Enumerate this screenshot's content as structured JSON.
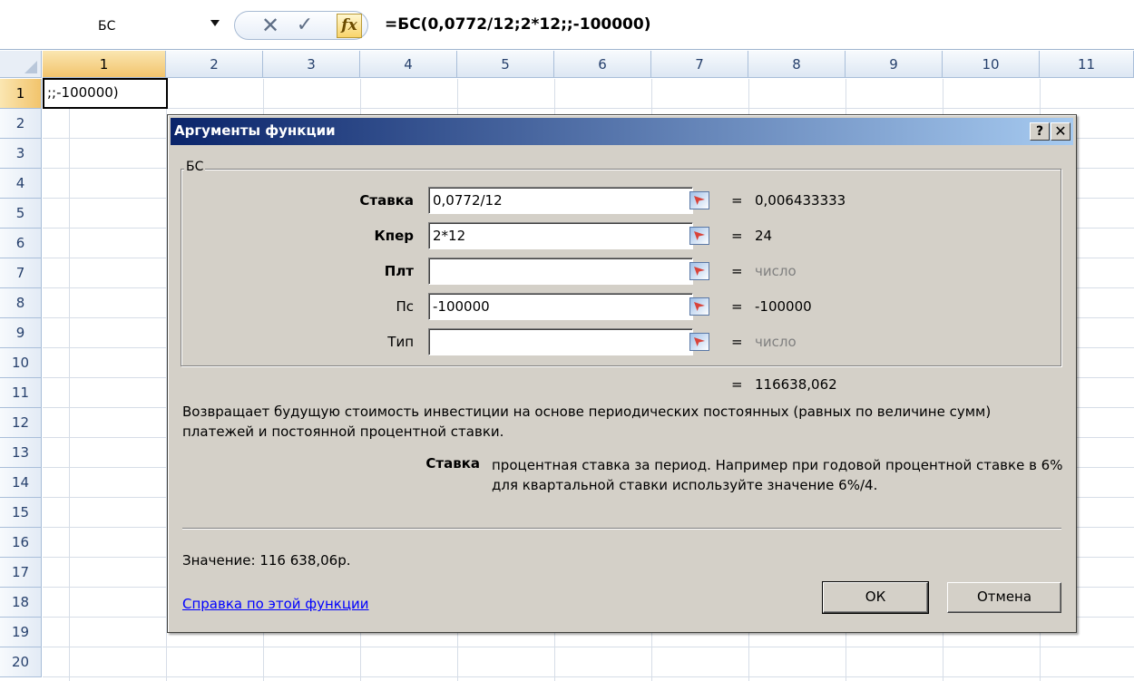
{
  "formula_bar": {
    "name_box": "БС",
    "cancel_glyph": "✕",
    "enter_glyph": "✓",
    "insert_function_label": "fx",
    "formula": "=БС(0,0772/12;2*12;;-100000)"
  },
  "sheet": {
    "columns": [
      "1",
      "2",
      "3",
      "4",
      "5",
      "6",
      "7",
      "8",
      "9",
      "10",
      "11"
    ],
    "rows": [
      "1",
      "2",
      "3",
      "4",
      "5",
      "6",
      "7",
      "8",
      "9",
      "10",
      "11",
      "12",
      "13",
      "14",
      "15",
      "16",
      "17",
      "18",
      "19",
      "20"
    ],
    "active_column": "1",
    "active_row": "1",
    "cell_a1_text": ";;-100000)"
  },
  "dialog": {
    "title": "Аргументы функции",
    "help_button": "?",
    "close_button": "✕",
    "function_name": "БС",
    "arguments": [
      {
        "label": "Ставка",
        "bold": true,
        "value": "0,0772/12",
        "result": "0,006433333",
        "result_placeholder": false
      },
      {
        "label": "Кпер",
        "bold": true,
        "value": "2*12",
        "result": "24",
        "result_placeholder": false
      },
      {
        "label": "Плт",
        "bold": true,
        "value": "",
        "result": "число",
        "result_placeholder": true
      },
      {
        "label": "Пс",
        "bold": false,
        "value": "-100000",
        "result": "-100000",
        "result_placeholder": false
      },
      {
        "label": "Тип",
        "bold": false,
        "value": "",
        "result": "число",
        "result_placeholder": true
      }
    ],
    "equals": "=",
    "formula_result": "116638,062",
    "description": "Возвращает будущую стоимость инвестиции на основе периодических постоянных (равных по величине сумм) платежей и постоянной процентной ставки.",
    "argument_help_name": "Ставка",
    "argument_help_text": "процентная ставка за период. Например при годовой процентной ставке в 6% для квартальной ставки используйте значение 6%/4.",
    "value_label": "Значение:",
    "value": "116 638,06р.",
    "help_link": "Справка по этой функции",
    "ok_button": "ОК",
    "cancel_button": "Отмена"
  },
  "colors": {
    "titlebar_start": "#0a246a",
    "titlebar_end": "#a6caf0",
    "dialog_face": "#d4d0c8",
    "link": "#0000ff",
    "active_header": "#f2c46c"
  }
}
